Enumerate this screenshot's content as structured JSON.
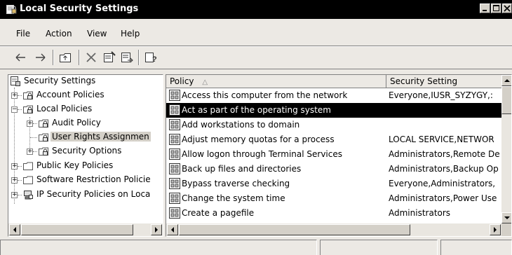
{
  "window": {
    "title": "Local Security Settings"
  },
  "menu": [
    "File",
    "Action",
    "View",
    "Help"
  ],
  "toolbar": {
    "icons": [
      "back-icon",
      "forward-icon",
      "up-folder-icon",
      "delete-icon",
      "properties-icon",
      "export-list-icon",
      "help-icon"
    ]
  },
  "tree": {
    "root": "Security Settings",
    "account_policies": "Account Policies",
    "local_policies": "Local Policies",
    "audit_policy": "Audit Policy",
    "user_rights": "User Rights Assignmen",
    "security_options": "Security Options",
    "public_key": "Public Key Policies",
    "software_restriction": "Software Restriction Policie",
    "ip_security": "IP Security Policies on Loca"
  },
  "list": {
    "columns": {
      "policy": "Policy",
      "sort_indicator": "△",
      "setting": "Security Setting"
    },
    "rows": [
      {
        "policy": "Access this computer from the network",
        "setting": "Everyone,IUSR_SYZYGY,:"
      },
      {
        "policy": "Act as part of the operating system",
        "setting": ""
      },
      {
        "policy": "Add workstations to domain",
        "setting": ""
      },
      {
        "policy": "Adjust memory quotas for a process",
        "setting": "LOCAL SERVICE,NETWOR"
      },
      {
        "policy": "Allow logon through Terminal Services",
        "setting": "Administrators,Remote De"
      },
      {
        "policy": "Back up files and directories",
        "setting": "Administrators,Backup Op"
      },
      {
        "policy": "Bypass traverse checking",
        "setting": "Everyone,Administrators,"
      },
      {
        "policy": "Change the system time",
        "setting": "Administrators,Power Use"
      },
      {
        "policy": "Create a pagefile",
        "setting": "Administrators"
      }
    ],
    "selected_row": "Act as part of the operating system"
  },
  "colors": {
    "titlebar": "#000000",
    "selection": "#000000",
    "chrome": "#ece9e4"
  }
}
